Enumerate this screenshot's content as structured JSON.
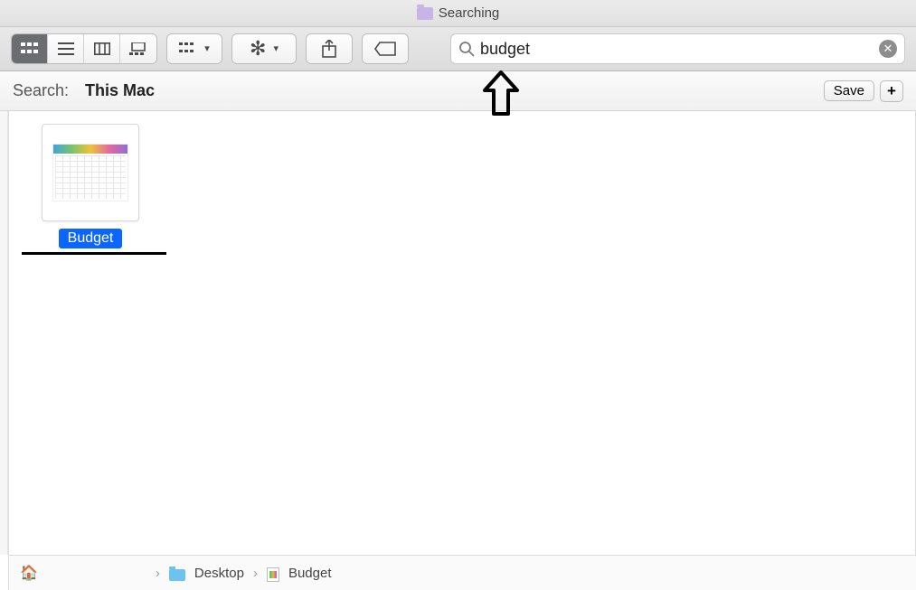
{
  "window": {
    "title": "Searching"
  },
  "search": {
    "query": "budget"
  },
  "scope": {
    "label": "Search:",
    "selected": "This Mac",
    "save": "Save",
    "plus": "+"
  },
  "results": [
    {
      "name": "Budget"
    }
  ],
  "path": {
    "home": "",
    "items": [
      {
        "name": "Desktop"
      },
      {
        "name": "Budget"
      }
    ]
  }
}
